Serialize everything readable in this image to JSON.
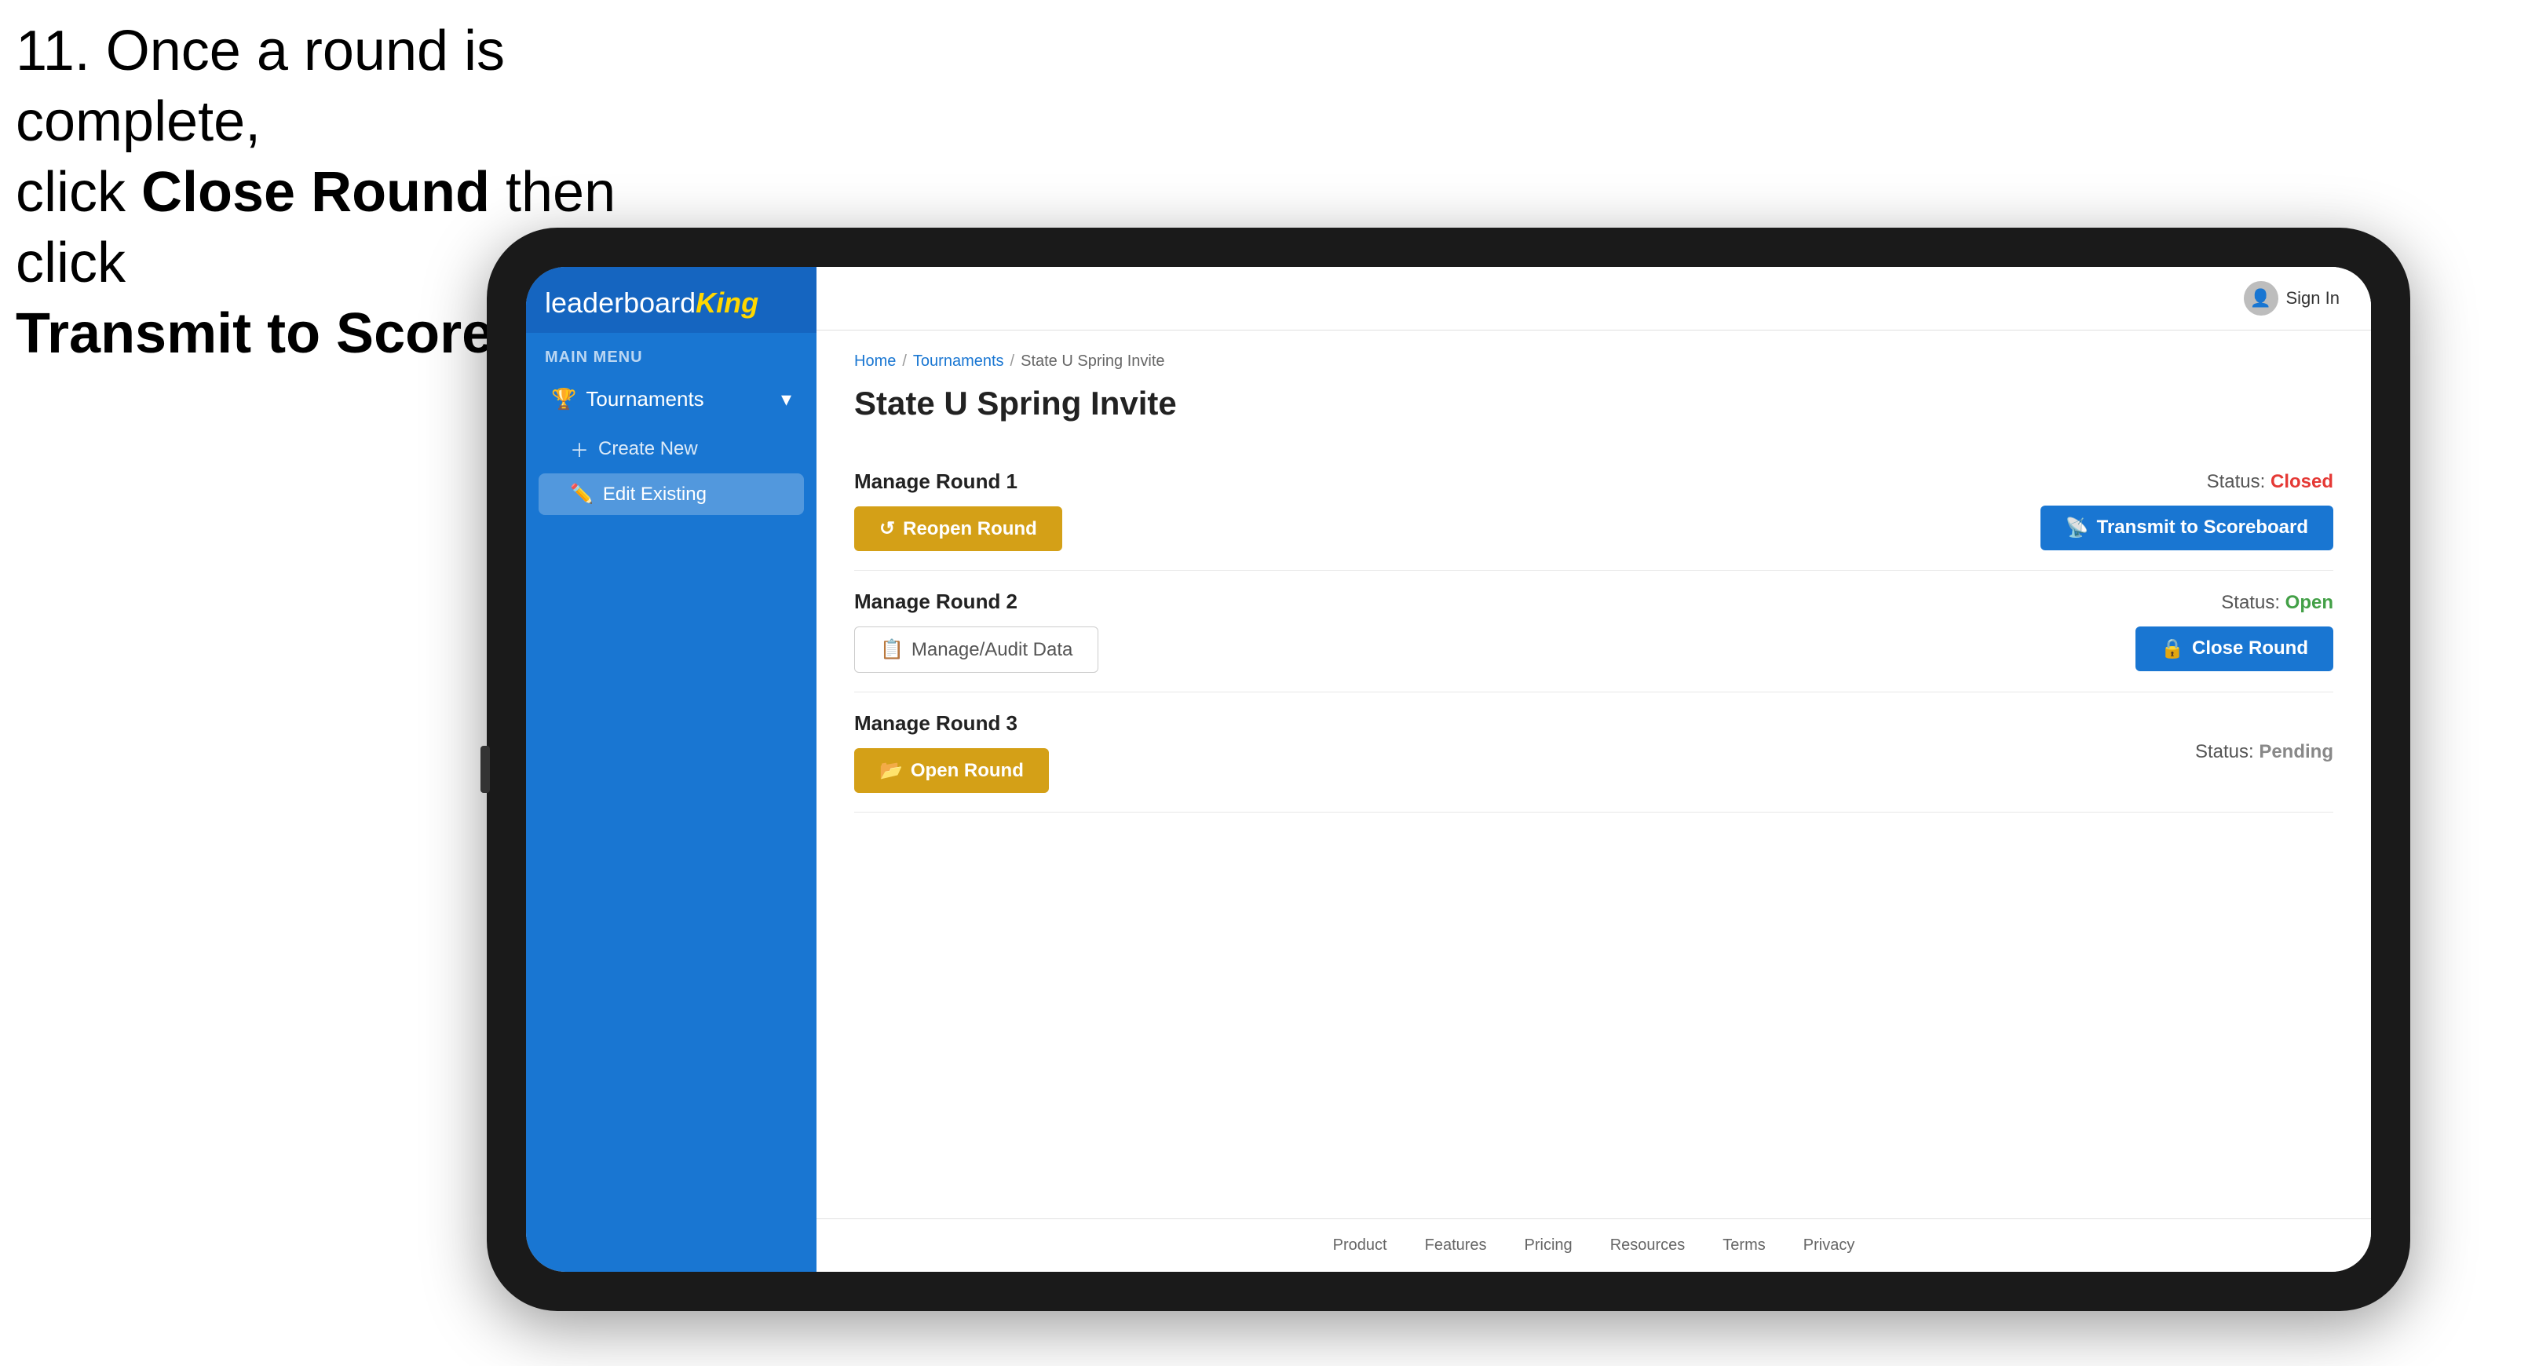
{
  "instruction": {
    "line1": "11. Once a round is complete,",
    "line2": "click ",
    "bold1": "Close Round",
    "line3": " then click",
    "bold2": "Transmit to Scoreboard."
  },
  "header": {
    "sign_in": "Sign In"
  },
  "sidebar": {
    "logo_leaderboard": "leaderboard",
    "logo_king": "King",
    "main_menu_label": "MAIN MENU",
    "nav_tournaments": "Tournaments",
    "sub_create_new": "Create New",
    "sub_edit_existing": "Edit Existing"
  },
  "breadcrumb": {
    "home": "Home",
    "sep1": "/",
    "tournaments": "Tournaments",
    "sep2": "/",
    "current": "State U Spring Invite"
  },
  "page": {
    "title": "State U Spring Invite"
  },
  "rounds": [
    {
      "id": "round1",
      "title": "Manage Round 1",
      "status_label": "Status:",
      "status_value": "Closed",
      "status_class": "status-closed",
      "buttons": [
        {
          "label": "Reopen Round",
          "type": "gold",
          "icon": "reopen"
        },
        {
          "label": "Transmit to Scoreboard",
          "type": "blue",
          "icon": "transmit"
        }
      ]
    },
    {
      "id": "round2",
      "title": "Manage Round 2",
      "status_label": "Status:",
      "status_value": "Open",
      "status_class": "status-open",
      "buttons": [
        {
          "label": "Manage/Audit Data",
          "type": "outline",
          "icon": "audit"
        },
        {
          "label": "Close Round",
          "type": "blue",
          "icon": "close"
        }
      ]
    },
    {
      "id": "round3",
      "title": "Manage Round 3",
      "status_label": "Status:",
      "status_value": "Pending",
      "status_class": "status-pending",
      "buttons": [
        {
          "label": "Open Round",
          "type": "gold",
          "icon": "open"
        }
      ]
    }
  ],
  "footer": {
    "links": [
      "Product",
      "Features",
      "Pricing",
      "Resources",
      "Terms",
      "Privacy"
    ]
  }
}
